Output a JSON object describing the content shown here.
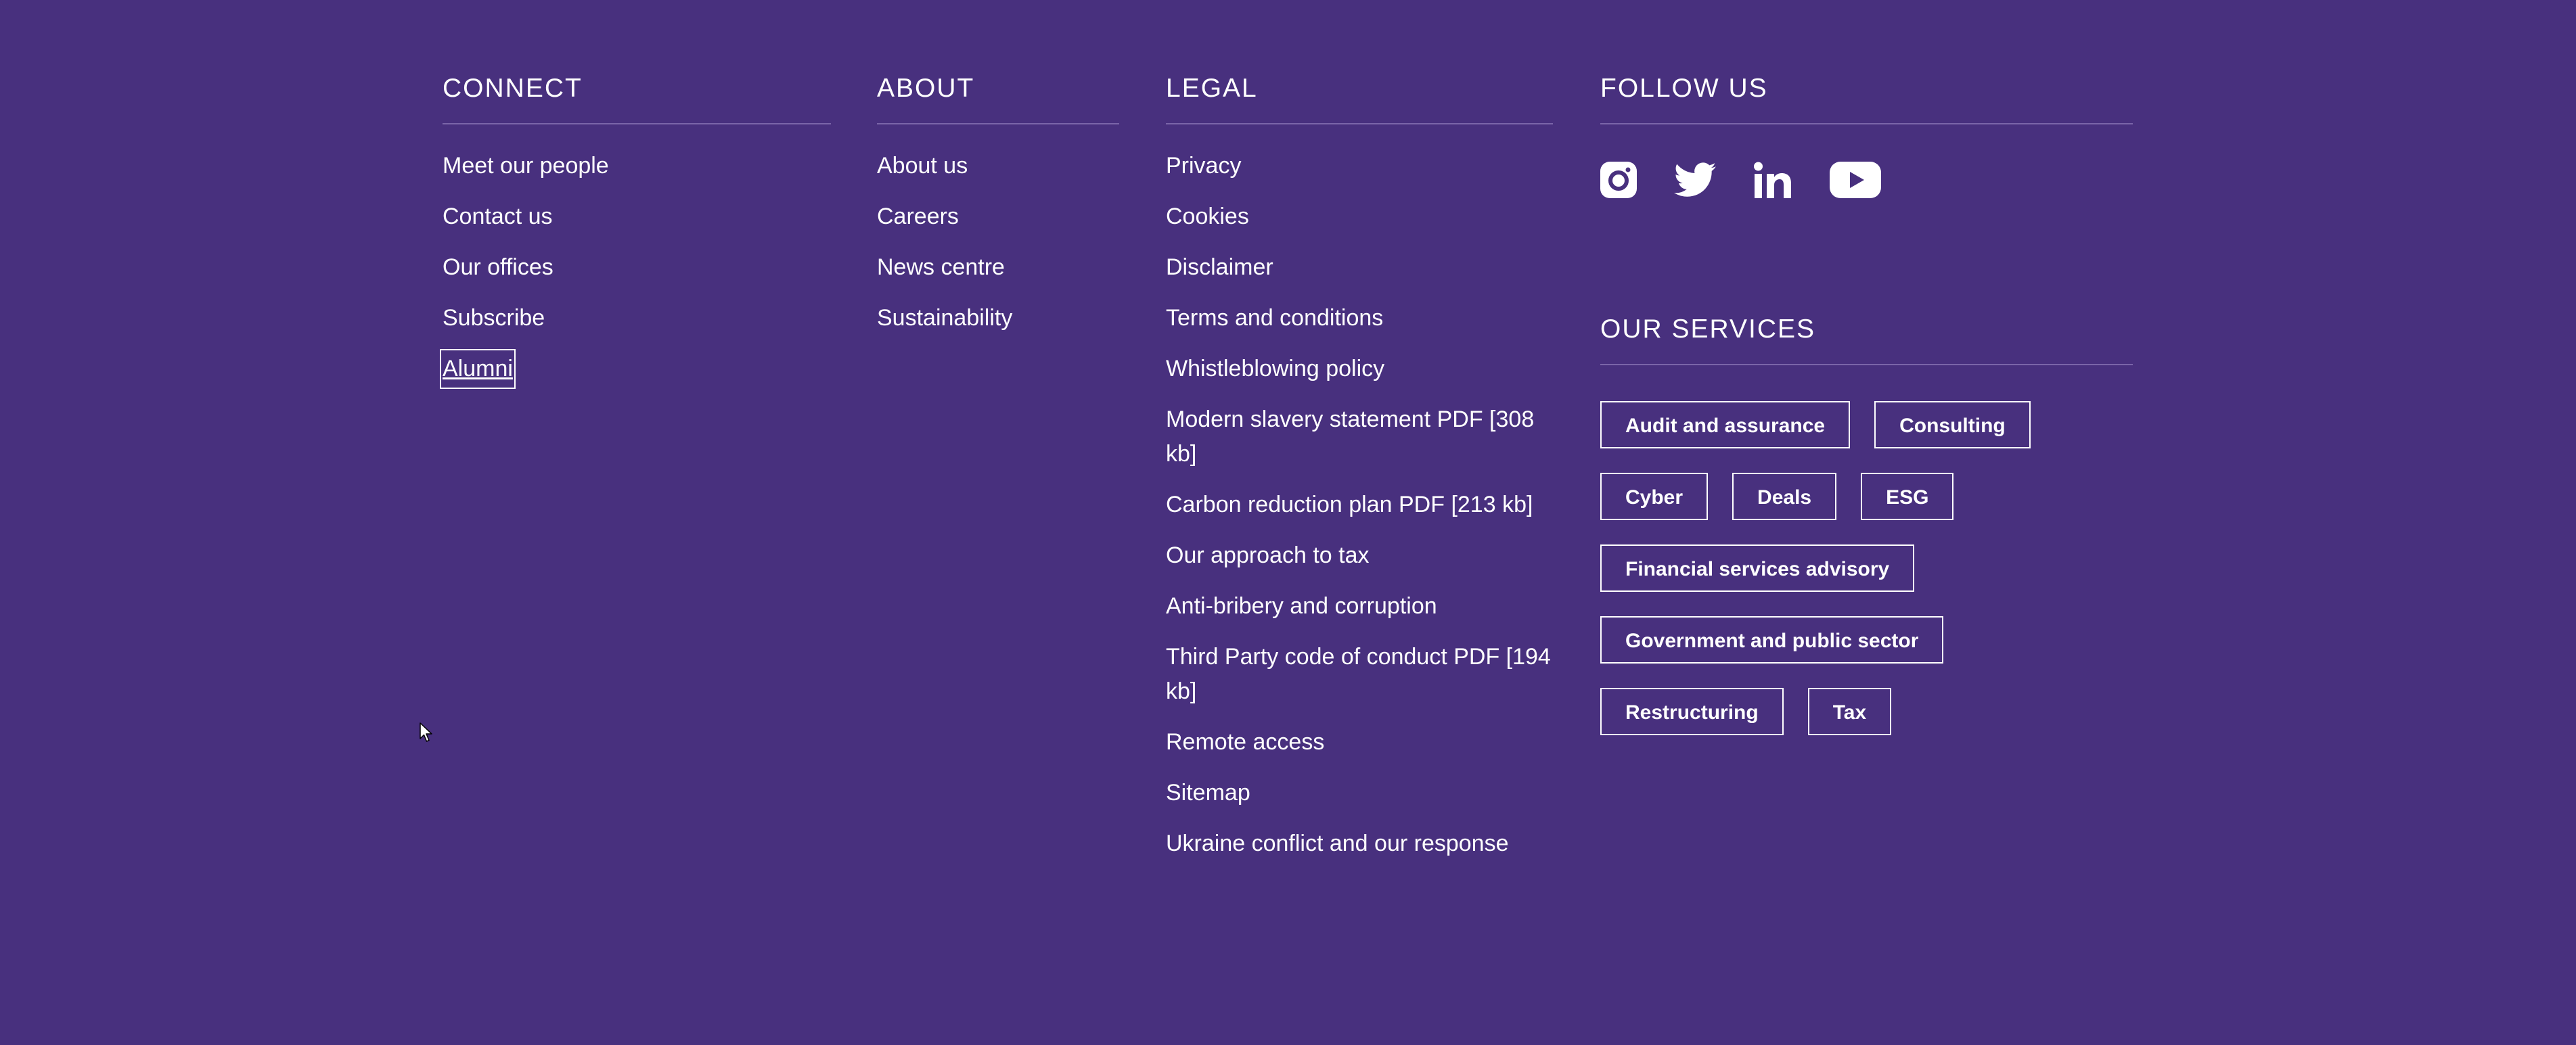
{
  "connect": {
    "title": "CONNECT",
    "items": [
      "Meet our people",
      "Contact us",
      "Our offices",
      "Subscribe",
      "Alumni"
    ]
  },
  "about": {
    "title": "ABOUT",
    "items": [
      "About us",
      "Careers",
      "News centre",
      "Sustainability"
    ]
  },
  "legal": {
    "title": "LEGAL",
    "items": [
      "Privacy",
      "Cookies",
      "Disclaimer",
      "Terms and conditions",
      "Whistleblowing policy",
      "Modern slavery statement PDF [308 kb]",
      "Carbon reduction plan PDF [213 kb]",
      "Our approach to tax",
      "Anti-bribery and corruption",
      "Third Party code of conduct PDF [194 kb]",
      "Remote access",
      "Sitemap",
      "Ukraine conflict and our response"
    ]
  },
  "follow": {
    "title": "FOLLOW US",
    "icons": [
      "instagram-icon",
      "twitter-icon",
      "linkedin-icon",
      "youtube-icon"
    ]
  },
  "services": {
    "title": "OUR SERVICES",
    "rows": [
      [
        "Audit and assurance",
        "Consulting"
      ],
      [
        "Cyber",
        "Deals",
        "ESG"
      ],
      [
        "Financial services advisory"
      ],
      [
        "Government and public sector"
      ],
      [
        "Restructuring",
        "Tax"
      ]
    ]
  },
  "colors": {
    "background": "#48307e",
    "text": "#ffffff",
    "divider": "#7a65a8"
  }
}
